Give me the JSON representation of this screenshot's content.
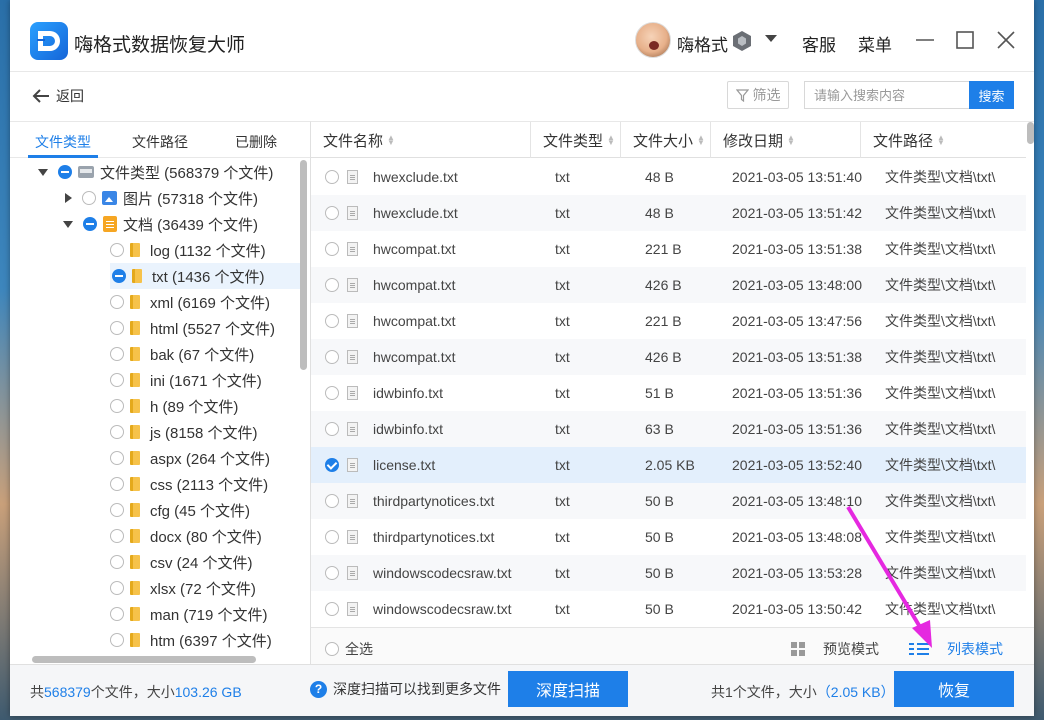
{
  "app": {
    "title": "嗨格式数据恢复大师",
    "user": "嗨格式",
    "service": "客服",
    "menu": "菜单",
    "back": "返回"
  },
  "toolbar": {
    "filter": "筛选",
    "search_placeholder": "请输入搜索内容",
    "search_button": "搜索"
  },
  "left_tabs": [
    "文件类型",
    "文件路径",
    "已删除"
  ],
  "tree": {
    "root": "文件类型 (568379 个文件)",
    "images": "图片 (57318 个文件)",
    "docs": "文档 (36439 个文件)",
    "children": [
      "log (1132 个文件)",
      "txt (1436 个文件)",
      "xml (6169 个文件)",
      "html (5527 个文件)",
      "bak (67 个文件)",
      "ini (1671 个文件)",
      "h (89 个文件)",
      "js (8158 个文件)",
      "aspx (264 个文件)",
      "css (2113 个文件)",
      "cfg (45 个文件)",
      "docx (80 个文件)",
      "csv (24 个文件)",
      "xlsx (72 个文件)",
      "man (719 个文件)",
      "htm (6397 个文件)"
    ]
  },
  "table": {
    "headers": [
      "文件名称",
      "文件类型",
      "文件大小",
      "修改日期",
      "文件路径"
    ],
    "rows": [
      {
        "name": "hwexclude.txt",
        "type": "txt",
        "size": "48 B",
        "date": "2021-03-05 13:51:40",
        "path": "文件类型\\文档\\txt\\"
      },
      {
        "name": "hwexclude.txt",
        "type": "txt",
        "size": "48 B",
        "date": "2021-03-05 13:51:42",
        "path": "文件类型\\文档\\txt\\"
      },
      {
        "name": "hwcompat.txt",
        "type": "txt",
        "size": "221 B",
        "date": "2021-03-05 13:51:38",
        "path": "文件类型\\文档\\txt\\"
      },
      {
        "name": "hwcompat.txt",
        "type": "txt",
        "size": "426 B",
        "date": "2021-03-05 13:48:00",
        "path": "文件类型\\文档\\txt\\"
      },
      {
        "name": "hwcompat.txt",
        "type": "txt",
        "size": "221 B",
        "date": "2021-03-05 13:47:56",
        "path": "文件类型\\文档\\txt\\"
      },
      {
        "name": "hwcompat.txt",
        "type": "txt",
        "size": "426 B",
        "date": "2021-03-05 13:51:38",
        "path": "文件类型\\文档\\txt\\"
      },
      {
        "name": "idwbinfo.txt",
        "type": "txt",
        "size": "51 B",
        "date": "2021-03-05 13:51:36",
        "path": "文件类型\\文档\\txt\\"
      },
      {
        "name": "idwbinfo.txt",
        "type": "txt",
        "size": "63 B",
        "date": "2021-03-05 13:51:36",
        "path": "文件类型\\文档\\txt\\"
      },
      {
        "name": "license.txt",
        "type": "txt",
        "size": "2.05 KB",
        "date": "2021-03-05 13:52:40",
        "path": "文件类型\\文档\\txt\\"
      },
      {
        "name": "thirdpartynotices.txt",
        "type": "txt",
        "size": "50 B",
        "date": "2021-03-05 13:48:10",
        "path": "文件类型\\文档\\txt\\"
      },
      {
        "name": "thirdpartynotices.txt",
        "type": "txt",
        "size": "50 B",
        "date": "2021-03-05 13:48:08",
        "path": "文件类型\\文档\\txt\\"
      },
      {
        "name": "windowscodecsraw.txt",
        "type": "txt",
        "size": "50 B",
        "date": "2021-03-05 13:53:28",
        "path": "文件类型\\文档\\txt\\"
      },
      {
        "name": "windowscodecsraw.txt",
        "type": "txt",
        "size": "50 B",
        "date": "2021-03-05 13:50:42",
        "path": "文件类型\\文档\\txt\\"
      }
    ],
    "select_all": "全选",
    "preview_mode": "预览模式",
    "list_mode": "列表模式"
  },
  "status": {
    "total_prefix": "共",
    "total_count": "568379",
    "total_mid": "个文件，大小",
    "total_size": "103.26 GB",
    "hint": "深度扫描可以找到更多文件",
    "deep_scan": "深度扫描",
    "selected_prefix": "共1个文件，大小",
    "selected_size": "（2.05 KB）",
    "recover": "恢复"
  },
  "colors": {
    "accent": "#1e7fe8",
    "annotation": "#e528e0"
  }
}
